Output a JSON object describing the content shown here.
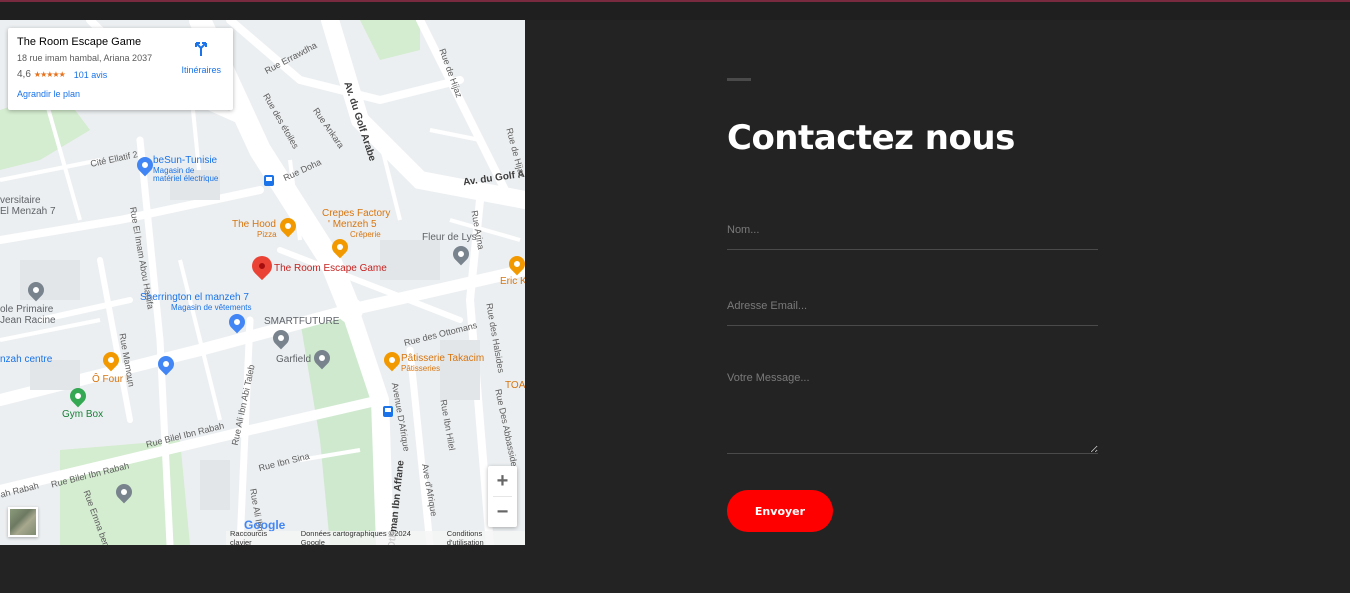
{
  "map": {
    "info_card": {
      "title": "The Room Escape Game",
      "address": "18 rue imam hambal, Ariana 2037",
      "rating": "4,6",
      "stars": "★★★★★",
      "reviews": "101 avis",
      "enlarge": "Agrandir le plan",
      "directions": "Itinéraires"
    },
    "streets": {
      "errawdha": "Rue Errawdha",
      "golf_arabe_v": "Av. du Golf Arabe",
      "golf_arabe_h": "Av. du Golf A",
      "hijaz1": "Rue de Hijaz",
      "hijaz2": "Rue de Hijaz",
      "etoiles": "Rue des étoiles",
      "ankara": "Rue Ankara",
      "doha": "Rue Doha",
      "elatif": "Cité Ellatif 2",
      "abou_hanifa": "Rue El Imam Abou Hanifa",
      "mamoun": "Rue Mamoun",
      "arina": "Rue Arina",
      "halsides": "Rue des Halsides",
      "ottomans": "Rue des Ottomans",
      "abbassides": "Rue Des Abbassides",
      "ibn_hilel": "Rue Ibn Hilel",
      "abi_taleb": "Rue Ali Ibn Abi Taleb",
      "ibn_sina": "Rue Ibn Sina",
      "bilel_1": "Rue Bilel Ibn Rabah",
      "bilel_2": "Rue Bilel Ibn Rabah",
      "afrique1": "Avenue D'Afrique",
      "afrique2": "Ave d'Afrique",
      "ibn_affane": "Rue Othman Ibn Affane",
      "ali_ibn": "Rue Ali Ibn",
      "emna": "Rue Emna bent W",
      "rabah": "ah Rabah"
    },
    "pois": {
      "room_escape": "The Room Escape Game",
      "besun": "beSun-Tunisie",
      "besun_sub1": "Magasin de",
      "besun_sub2": "matériel électrique",
      "hood": "The Hood",
      "hood_sub": "Pizza",
      "crepes1": "Crepes Factory",
      "crepes2": "' Menzeh 5",
      "crepes_sub": "Crêperie",
      "fleur": "Fleur de Lys",
      "eric": "Eric K",
      "sherrington": "Sherrington el manzeh 7",
      "sherrington_sub": "Magasin de vêtements",
      "smartfuture": "SMARTFUTURE",
      "garfield": "Garfield",
      "takacim": "Pâtisserie Takacim",
      "takacim_sub": "Pâtisseries",
      "toa": "TOA",
      "ofour": "Ô Four !",
      "gymbox": "Gym Box",
      "universitaire": "versitaire",
      "menzeh7": "El Menzah 7",
      "ecole1": "ole Primaire",
      "ecole2": "Jean Racine",
      "menzah_centre": "nzah centre"
    },
    "google": "Google",
    "footer": {
      "shortcuts": "Raccourcis clavier",
      "data": "Données cartographiques ©2024 Google",
      "terms": "Conditions d'utilisation"
    },
    "zoom_in": "+",
    "zoom_out": "−"
  },
  "contact": {
    "title": "Contactez nous",
    "name_placeholder": "Nom...",
    "email_placeholder": "Adresse Email...",
    "message_placeholder": "Votre Message...",
    "submit": "Envoyer"
  },
  "colors": {
    "background": "#232323",
    "accent": "#ff0000",
    "pin": "#ea4335"
  }
}
